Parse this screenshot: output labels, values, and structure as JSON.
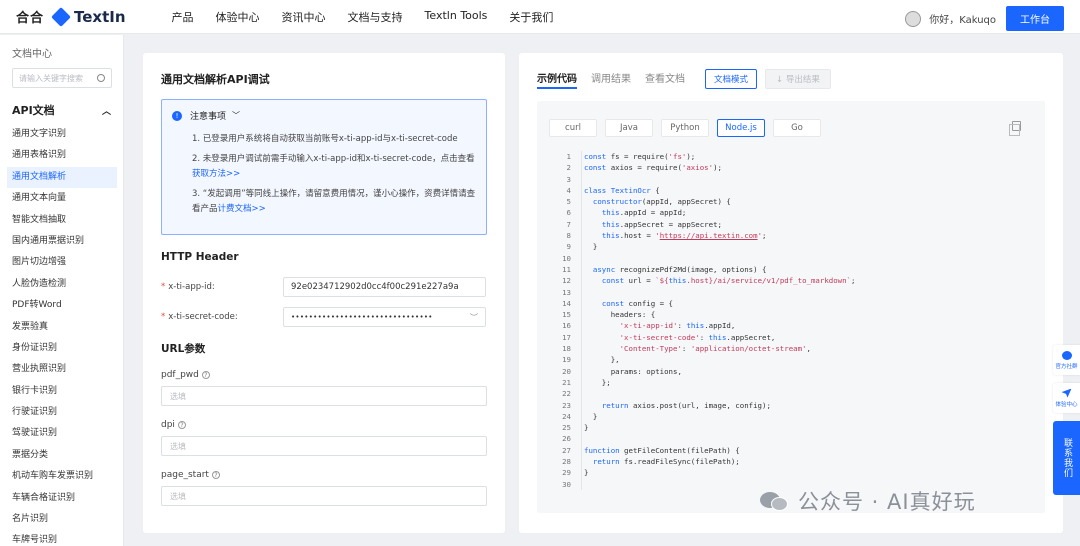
{
  "topbar": {
    "logo_left": "合合",
    "logo_text": "TextIn",
    "nav": [
      "产品",
      "体验中心",
      "资讯中心",
      "文档与支持",
      "Textln Tools",
      "关于我们"
    ],
    "greeting": "你好，Kakuqo",
    "workbench_button": "工作台"
  },
  "sidebar": {
    "title": "文档中心",
    "search_placeholder": "请输入关键字搜索",
    "section": "API文档",
    "items": [
      "通用文字识别",
      "通用表格识别",
      "通用文档解析",
      "通用文本向量",
      "智能文档抽取",
      "国内通用票据识别",
      "图片切边增强",
      "人脸伪造检测",
      "PDF转Word",
      "发票验真",
      "身份证识别",
      "营业执照识别",
      "银行卡识别",
      "行驶证识别",
      "驾驶证识别",
      "票据分类",
      "机动车购车发票识别",
      "车辆合格证识别",
      "名片识别",
      "车牌号识别"
    ],
    "active_index": 2
  },
  "left": {
    "title": "通用文档解析API调试",
    "notice_title": "注意事项",
    "notice_items": [
      {
        "text": "1. 已登录用户系统将自动获取当前账号x-ti-app-id与x-ti-secret-code",
        "link": ""
      },
      {
        "text": "2. 未登录用户调试前需手动输入x-ti-app-id和x-ti-secret-code，点击查看",
        "link": "获取方法>>"
      },
      {
        "text": "3. “发起调用”等同线上操作，请留意费用情况，谨小心操作，资费详情请查看产品",
        "link": "计费文档>>"
      }
    ],
    "http_header_title": "HTTP Header",
    "app_id_label": "x-ti-app-id:",
    "app_id_value": "92e0234712902d0cc4f00c291e227a9a",
    "secret_label": "x-ti-secret-code:",
    "secret_value": "••••••••••••••••••••••••••••••••",
    "url_params_title": "URL参数",
    "params": [
      {
        "label": "pdf_pwd",
        "placeholder": "选填"
      },
      {
        "label": "dpi",
        "placeholder": "选填"
      },
      {
        "label": "page_start",
        "placeholder": "选填"
      }
    ]
  },
  "right": {
    "tabs": [
      "示例代码",
      "调用结果",
      "查看文档"
    ],
    "doc_mode_button": "文档模式",
    "export_button": "导出结果",
    "languages": [
      "curl",
      "Java",
      "Python",
      "Node.js",
      "Go"
    ],
    "active_language": 3,
    "code": [
      [
        {
          "t": "kw",
          "v": "const"
        },
        {
          "t": "",
          "v": " fs = require("
        },
        {
          "t": "st",
          "v": "'fs'"
        },
        {
          "t": "",
          "v": ");"
        }
      ],
      [
        {
          "t": "kw",
          "v": "const"
        },
        {
          "t": "",
          "v": " axios = require("
        },
        {
          "t": "st",
          "v": "'axios'"
        },
        {
          "t": "",
          "v": ");"
        }
      ],
      [],
      [
        {
          "t": "kw",
          "v": "class"
        },
        {
          "t": "",
          "v": " "
        },
        {
          "t": "kw",
          "v": "TextinOcr"
        },
        {
          "t": "",
          "v": " {"
        }
      ],
      [
        {
          "t": "",
          "v": "  "
        },
        {
          "t": "kw",
          "v": "constructor"
        },
        {
          "t": "",
          "v": "(appId, appSecret) {"
        }
      ],
      [
        {
          "t": "",
          "v": "    "
        },
        {
          "t": "kw",
          "v": "this"
        },
        {
          "t": "",
          "v": ".appId = appId;"
        }
      ],
      [
        {
          "t": "",
          "v": "    "
        },
        {
          "t": "kw",
          "v": "this"
        },
        {
          "t": "",
          "v": ".appSecret = appSecret;"
        }
      ],
      [
        {
          "t": "",
          "v": "    "
        },
        {
          "t": "kw",
          "v": "this"
        },
        {
          "t": "",
          "v": ".host = "
        },
        {
          "t": "st",
          "v": "'"
        },
        {
          "t": "ul",
          "v": "https://api.textin.com"
        },
        {
          "t": "st",
          "v": "'"
        },
        {
          "t": "",
          "v": ";"
        }
      ],
      [
        {
          "t": "",
          "v": "  }"
        }
      ],
      [],
      [
        {
          "t": "",
          "v": "  "
        },
        {
          "t": "kw",
          "v": "async"
        },
        {
          "t": "",
          "v": " recognizePdf2Md(image, options) {"
        }
      ],
      [
        {
          "t": "",
          "v": "    "
        },
        {
          "t": "kw",
          "v": "const"
        },
        {
          "t": "",
          "v": " url = "
        },
        {
          "t": "st",
          "v": "`${"
        },
        {
          "t": "kw",
          "v": "this"
        },
        {
          "t": "st",
          "v": ".host}/ai/service/v1/pdf_to_markdown`"
        },
        {
          "t": "",
          "v": ";"
        }
      ],
      [],
      [
        {
          "t": "",
          "v": "    "
        },
        {
          "t": "kw",
          "v": "const"
        },
        {
          "t": "",
          "v": " config = {"
        }
      ],
      [
        {
          "t": "",
          "v": "      headers: {"
        }
      ],
      [
        {
          "t": "",
          "v": "        "
        },
        {
          "t": "st",
          "v": "'x-ti-app-id'"
        },
        {
          "t": "",
          "v": ": "
        },
        {
          "t": "kw",
          "v": "this"
        },
        {
          "t": "",
          "v": ".appId,"
        }
      ],
      [
        {
          "t": "",
          "v": "        "
        },
        {
          "t": "st",
          "v": "'x-ti-secret-code'"
        },
        {
          "t": "",
          "v": ": "
        },
        {
          "t": "kw",
          "v": "this"
        },
        {
          "t": "",
          "v": ".appSecret,"
        }
      ],
      [
        {
          "t": "",
          "v": "        "
        },
        {
          "t": "st",
          "v": "'Content-Type'"
        },
        {
          "t": "",
          "v": ": "
        },
        {
          "t": "st",
          "v": "'application/octet-stream'"
        },
        {
          "t": "",
          "v": ","
        }
      ],
      [
        {
          "t": "",
          "v": "      },"
        }
      ],
      [
        {
          "t": "",
          "v": "      params: options,"
        }
      ],
      [
        {
          "t": "",
          "v": "    };"
        }
      ],
      [],
      [
        {
          "t": "",
          "v": "    "
        },
        {
          "t": "kw",
          "v": "return"
        },
        {
          "t": "",
          "v": " axios.post(url, image, config);"
        }
      ],
      [
        {
          "t": "",
          "v": "  }"
        }
      ],
      [
        {
          "t": "",
          "v": "}"
        }
      ],
      [],
      [
        {
          "t": "kw",
          "v": "function"
        },
        {
          "t": "",
          "v": " getFileContent(filePath) {"
        }
      ],
      [
        {
          "t": "",
          "v": "  "
        },
        {
          "t": "kw",
          "v": "return"
        },
        {
          "t": "",
          "v": " fs.readFileSync(filePath);"
        }
      ],
      [
        {
          "t": "",
          "v": "}"
        }
      ],
      []
    ]
  },
  "float_rail": {
    "community": "官方社群",
    "experience": "体验中心",
    "contact": "联系我们"
  },
  "watermark": "公众号 · AI真好玩",
  "colors": {
    "accent": "#1a66ff",
    "string": "#c23a5a",
    "required": "#e74c3c"
  }
}
